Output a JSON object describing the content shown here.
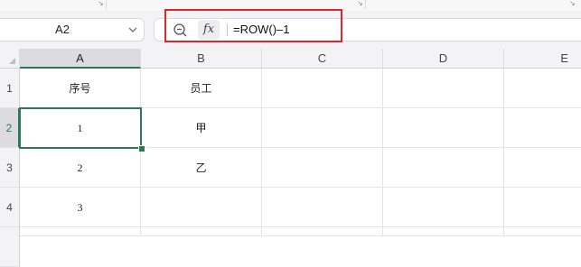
{
  "namebox": {
    "value": "A2"
  },
  "formula_bar": {
    "fx_label": "fx",
    "formula": "=ROW()–1"
  },
  "columns": [
    "A",
    "B",
    "C",
    "D",
    "E"
  ],
  "rows": [
    "1",
    "2",
    "3",
    "4"
  ],
  "cells": {
    "A1": "序号",
    "B1": "员工",
    "A2": "1",
    "B2": "甲",
    "A3": "2",
    "B3": "乙",
    "A4": "3"
  },
  "selection": {
    "active_cell": "A2"
  },
  "colors": {
    "selection": "#2a7a52",
    "highlight_box": "#e0262a"
  },
  "icons": [
    "chevron-down-icon",
    "zoom-out-icon",
    "function-icon",
    "select-all-icon",
    "dialog-launcher-icon"
  ]
}
